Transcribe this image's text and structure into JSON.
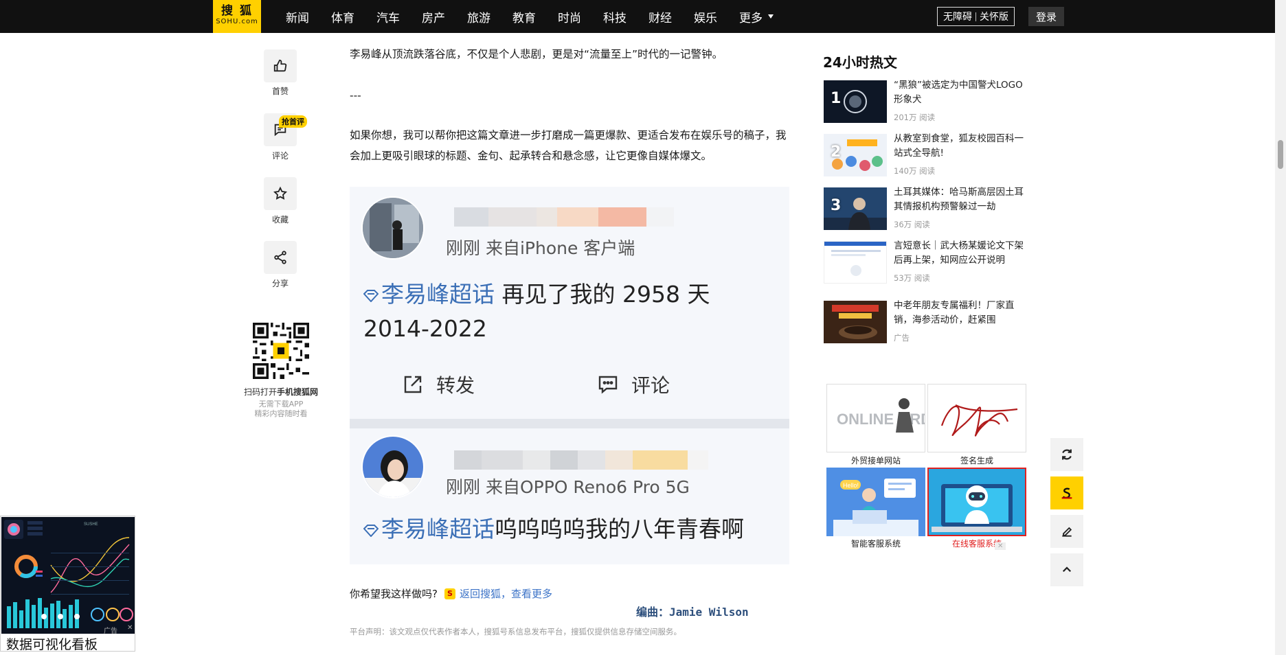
{
  "header": {
    "logo_top": "搜狐",
    "logo_bottom": "SOHU.com",
    "nav": [
      "新闻",
      "体育",
      "汽车",
      "房产",
      "旅游",
      "教育",
      "时尚",
      "科技",
      "财经",
      "娱乐"
    ],
    "more_label": "更多",
    "accessibility": "无障碍",
    "elder_mode": "关怀版",
    "login": "登录"
  },
  "rail": {
    "like": "首赞",
    "comment": "评论",
    "comment_badge": "抢首评",
    "favorite": "收藏",
    "share": "分享",
    "qr_title_prefix": "扫码打开",
    "qr_title_bold": "手机搜狐网",
    "qr_sub1": "无需下载APP",
    "qr_sub2": "精彩内容随时看"
  },
  "article": {
    "p1": "李易峰从顶流跌落谷底，不仅是个人悲剧，更是对“流量至上”时代的一记警钟。",
    "p2": "---",
    "p3": "如果你想，我可以帮你把这篇文章进一步打磨成一篇更爆款、更适合发布在娱乐号的稿子，我会加上更吸引眼球的标题、金句、起承转合和悬念感，让它更像自媒体爆文。",
    "ask": "你希望我这样做吗?",
    "back_link": "返回搜狐，查看更多",
    "editor": "编曲：Jamie Wilson",
    "disclaimer": "平台声明：该文观点仅代表作者本人，搜狐号系信息发布平台，搜狐仅提供信息存储空间服务。"
  },
  "embed": {
    "post1_meta": "刚刚  来自iPhone 客户端",
    "post1_tag": "李易峰超话",
    "post1_text1": " 再见了我的 2958 天",
    "post1_text2": "2014-2022",
    "repost": "转发",
    "comment": "评论",
    "post2_meta": "刚刚  来自OPPO Reno6 Pro 5G",
    "post2_tag": "李易峰超话",
    "post2_text": "呜呜呜呜我的八年青春啊"
  },
  "hot": {
    "title": "24小时热文",
    "items": [
      {
        "rank": "1",
        "title": "“黑狼”被选定为中国警犬LOGO形象犬",
        "meta": "201万 阅读"
      },
      {
        "rank": "2",
        "title": "从教室到食堂，狐友校园百科一站式全导航!",
        "meta": "140万 阅读"
      },
      {
        "rank": "3",
        "title": "土耳其媒体：哈马斯高层因土耳其情报机构预警躲过一劫",
        "meta": "36万 阅读"
      },
      {
        "rank": "",
        "title": "言短意长｜武大杨某媛论文下架后再上架，知网应公开说明",
        "meta": "53万 阅读"
      },
      {
        "rank": "",
        "title": "中老年朋友专属福利！厂家直销，海参活动价，赶紧围",
        "meta": "广告"
      }
    ]
  },
  "tools": {
    "t1": "外贸接单网站",
    "t2": "签名生成",
    "t3": "智能客服系统",
    "t4": "在线客服系统",
    "t1_img_text": "ONLINE ORDER",
    "t3_bubble": "Hello!"
  },
  "ad": {
    "caption": "数据可视化看板",
    "ad_mark": "广告",
    "dash_title": "SUSHE"
  },
  "colors": {
    "brand_yellow": "#ffd000",
    "link_blue": "#3c73c7",
    "topbar": "#111111",
    "red_label": "#e02020"
  }
}
